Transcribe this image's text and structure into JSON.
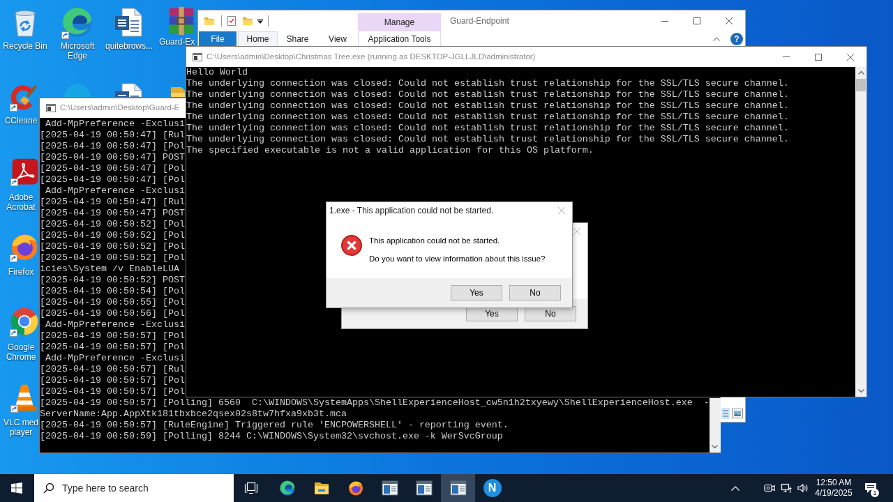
{
  "desktop": {
    "icons": [
      {
        "kind": "recycle-bin",
        "label": "Recycle Bin",
        "shortcut": false
      },
      {
        "kind": "ccleaner",
        "label": "CCleane",
        "shortcut": true
      },
      {
        "kind": "acrobat",
        "label": "Adobe Acrobat",
        "shortcut": true
      },
      {
        "kind": "firefox",
        "label": "Firefox",
        "shortcut": true
      },
      {
        "kind": "chrome",
        "label": "Google Chrome",
        "shortcut": true
      },
      {
        "kind": "vlc",
        "label": "VLC med player",
        "shortcut": true
      },
      {
        "kind": "edge",
        "label": "Microsoft Edge",
        "shortcut": true
      },
      {
        "kind": "skype"
      },
      {
        "kind": "word",
        "label": "quitebrows...",
        "shortcut": false
      },
      {
        "kind": "word"
      },
      {
        "kind": "winrar",
        "label": "Guard-Ex",
        "shortcut": false
      },
      {
        "kind": "folder"
      }
    ]
  },
  "explorer": {
    "title": "Guard-Endpoint",
    "contextual_label": "Manage",
    "tabs": [
      {
        "label": "File",
        "kind": "file",
        "selected": false
      },
      {
        "label": "Home",
        "kind": "tab",
        "selected": true
      },
      {
        "label": "Share",
        "kind": "tab",
        "selected": false
      },
      {
        "label": "View",
        "kind": "tab",
        "selected": false
      },
      {
        "label": "Application Tools",
        "kind": "contextual",
        "selected": false
      }
    ],
    "help": "?"
  },
  "consoles": [
    {
      "title": "C:\\Users\\admin\\Desktop\\Christmas Tree.exe (running as DESKTOP-JGLLJLD\\administrator)",
      "lines": [
        "Hello World",
        "The underlying connection was closed: Could not establish trust relationship for the SSL/TLS secure channel.",
        "The underlying connection was closed: Could not establish trust relationship for the SSL/TLS secure channel.",
        "The underlying connection was closed: Could not establish trust relationship for the SSL/TLS secure channel.",
        "The underlying connection was closed: Could not establish trust relationship for the SSL/TLS secure channel.",
        "The underlying connection was closed: Could not establish trust relationship for the SSL/TLS secure channel.",
        "The underlying connection was closed: Could not establish trust relationship for the SSL/TLS secure channel.",
        "The specified executable is not a valid application for this OS platform."
      ]
    },
    {
      "title": "C:\\Users\\admin\\Desktop\\Guard-E",
      "lines": [
        " Add-MpPreference -Exclusi",
        "[2025-04-19 00:50:47] [Rul",
        "[2025-04-19 00:50:47] [Pol",
        "[2025-04-19 00:50:47] POST",
        "[2025-04-19 00:50:47] [Pol",
        "[2025-04-19 00:50:47] [Pol",
        " Add-MpPreference -Exclusi",
        "[2025-04-19 00:50:47] [Rul",
        "[2025-04-19 00:50:47] POST",
        "[2025-04-19 00:50:52] [Pol",
        "[2025-04-19 00:50:52] [Pol",
        "[2025-04-19 00:50:52] [Pol",
        "[2025-04-19 00:50:52] [Pol",
        "icies\\System /v EnableLUA",
        "[2025-04-19 00:50:52] POST",
        "[2025-04-19 00:50:54] [Pol",
        "[2025-04-19 00:50:55] [Pol",
        "[2025-04-19 00:50:56] [Pol",
        " Add-MpPreference -Exclusi",
        "[2025-04-19 00:50:57] [Pol",
        "[2025-04-19 00:50:57] [Pol",
        " Add-MpPreference -Exclusi",
        "[2025-04-19 00:50:57] [Rul",
        "[2025-04-19 00:50:57] [Pol",
        "[2025-04-19 00:50:57] [Pol",
        "[2025-04-19 00:50:57] [Polling] 6560  C:\\WINDOWS\\SystemApps\\ShellExperienceHost_cw5n1h2txyewy\\ShellExperienceHost.exe  -",
        "ServerName:App.AppXtk181tbxbce2qsex02s8tw7hfxa9xb3t.mca",
        "[2025-04-19 00:50:57] [RuleEngine] Triggered rule 'ENCPOWERSHELL' - reporting event.",
        "[2025-04-19 00:50:59] [Polling] 8244 C:\\WINDOWS\\System32\\svchost.exe -k WerSvcGroup"
      ]
    }
  ],
  "dialogs": [
    {
      "title": "1.exe - This application could not be started.",
      "kind": "error",
      "message": "This application could not be started.",
      "question": "Do you want to view information about this issue?",
      "buttons": [
        "Yes",
        "No"
      ]
    },
    {
      "buttons": [
        "Yes",
        "No"
      ]
    }
  ],
  "taskbar": {
    "search": {
      "placeholder": "Type here to search"
    },
    "apps": [
      {
        "kind": "edge",
        "selected": false
      },
      {
        "kind": "explorer",
        "selected": false
      },
      {
        "kind": "firefox",
        "selected": false
      },
      {
        "kind": "console",
        "selected": false
      },
      {
        "kind": "console",
        "selected": false
      },
      {
        "kind": "console",
        "selected": true
      },
      {
        "kind": "letter",
        "glyph": "N",
        "selected": false
      }
    ],
    "time": "12:50 AM",
    "date": "4/19/2025",
    "notification_count": "1"
  }
}
